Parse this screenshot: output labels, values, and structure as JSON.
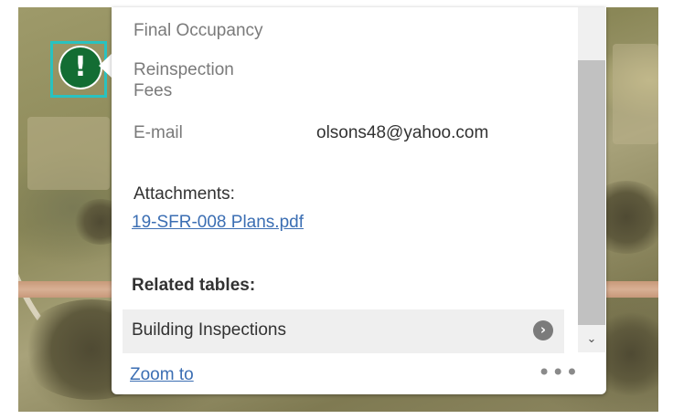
{
  "marker": {
    "icon": "alert-exclamation-icon",
    "glyph": "!",
    "color": "#136d33",
    "highlight_color": "#29c2c0"
  },
  "popup": {
    "fields": [
      {
        "label": "Final Occupancy",
        "value": ""
      },
      {
        "label": "Reinspection Fees",
        "value": ""
      },
      {
        "label": "E-mail",
        "value": "olsons48@yahoo.com"
      }
    ],
    "attachments_label": "Attachments:",
    "attachment_link": "19-SFR-008 Plans.pdf",
    "related_title": "Related tables:",
    "related_item": "Building Inspections",
    "related_item_icon": "chevron-right-circle-icon",
    "chevron_glyph": "›",
    "zoom_link": "Zoom to",
    "more_glyph": "•••",
    "scroll_down_glyph": "⌄"
  },
  "colors": {
    "link": "#3b6eb3",
    "label": "#7a7a7a",
    "text": "#323232"
  }
}
